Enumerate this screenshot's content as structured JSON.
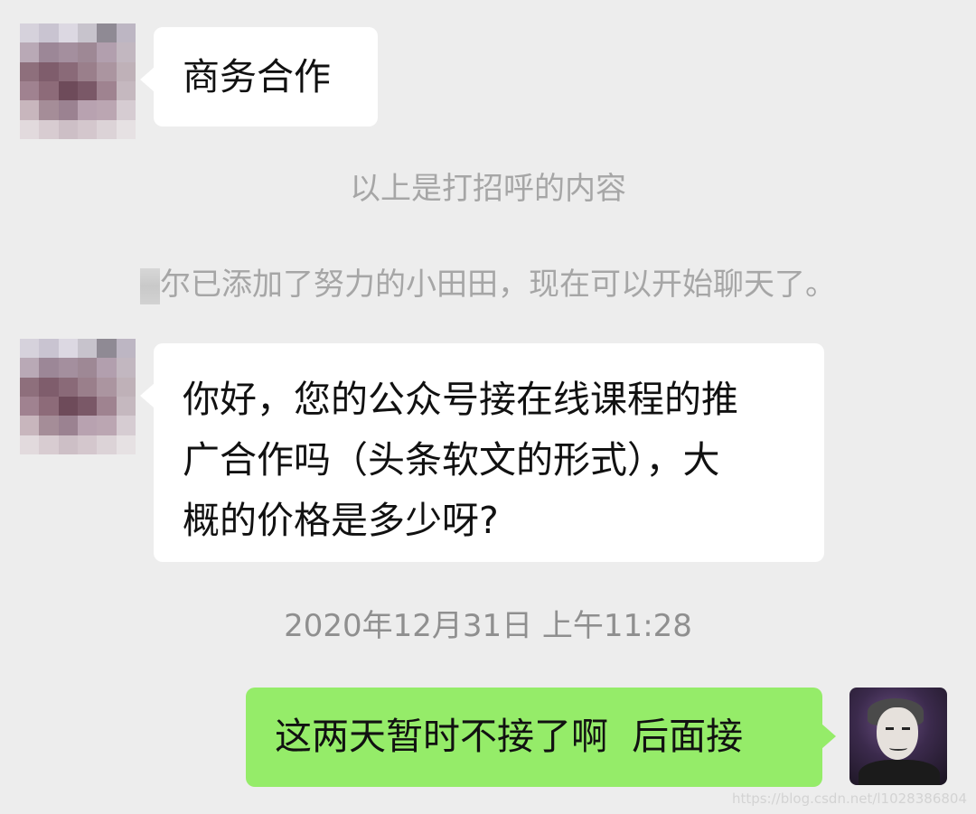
{
  "messages": [
    {
      "side": "left",
      "text": "商务合作"
    },
    {
      "side": "left",
      "lines": [
        "你好，您的公众号接在线课程的推",
        "广合作吗（头条软文的形式），大",
        "概的价格是多少呀?"
      ]
    },
    {
      "side": "right",
      "text": "这两天暂时不接了啊  后面接"
    }
  ],
  "system": {
    "greeting_note": "以上是打招呼的内容",
    "added_notice": "尔已添加了努力的小田田，现在可以开始聊天了。",
    "timestamp": "2020年12月31日 上午11:28"
  },
  "watermark": "https://blog.csdn.net/l1028386804",
  "colors": {
    "background": "#ededed",
    "incoming_bubble": "#ffffff",
    "outgoing_bubble": "#95ec69",
    "system_text": "#a6a6a6"
  }
}
